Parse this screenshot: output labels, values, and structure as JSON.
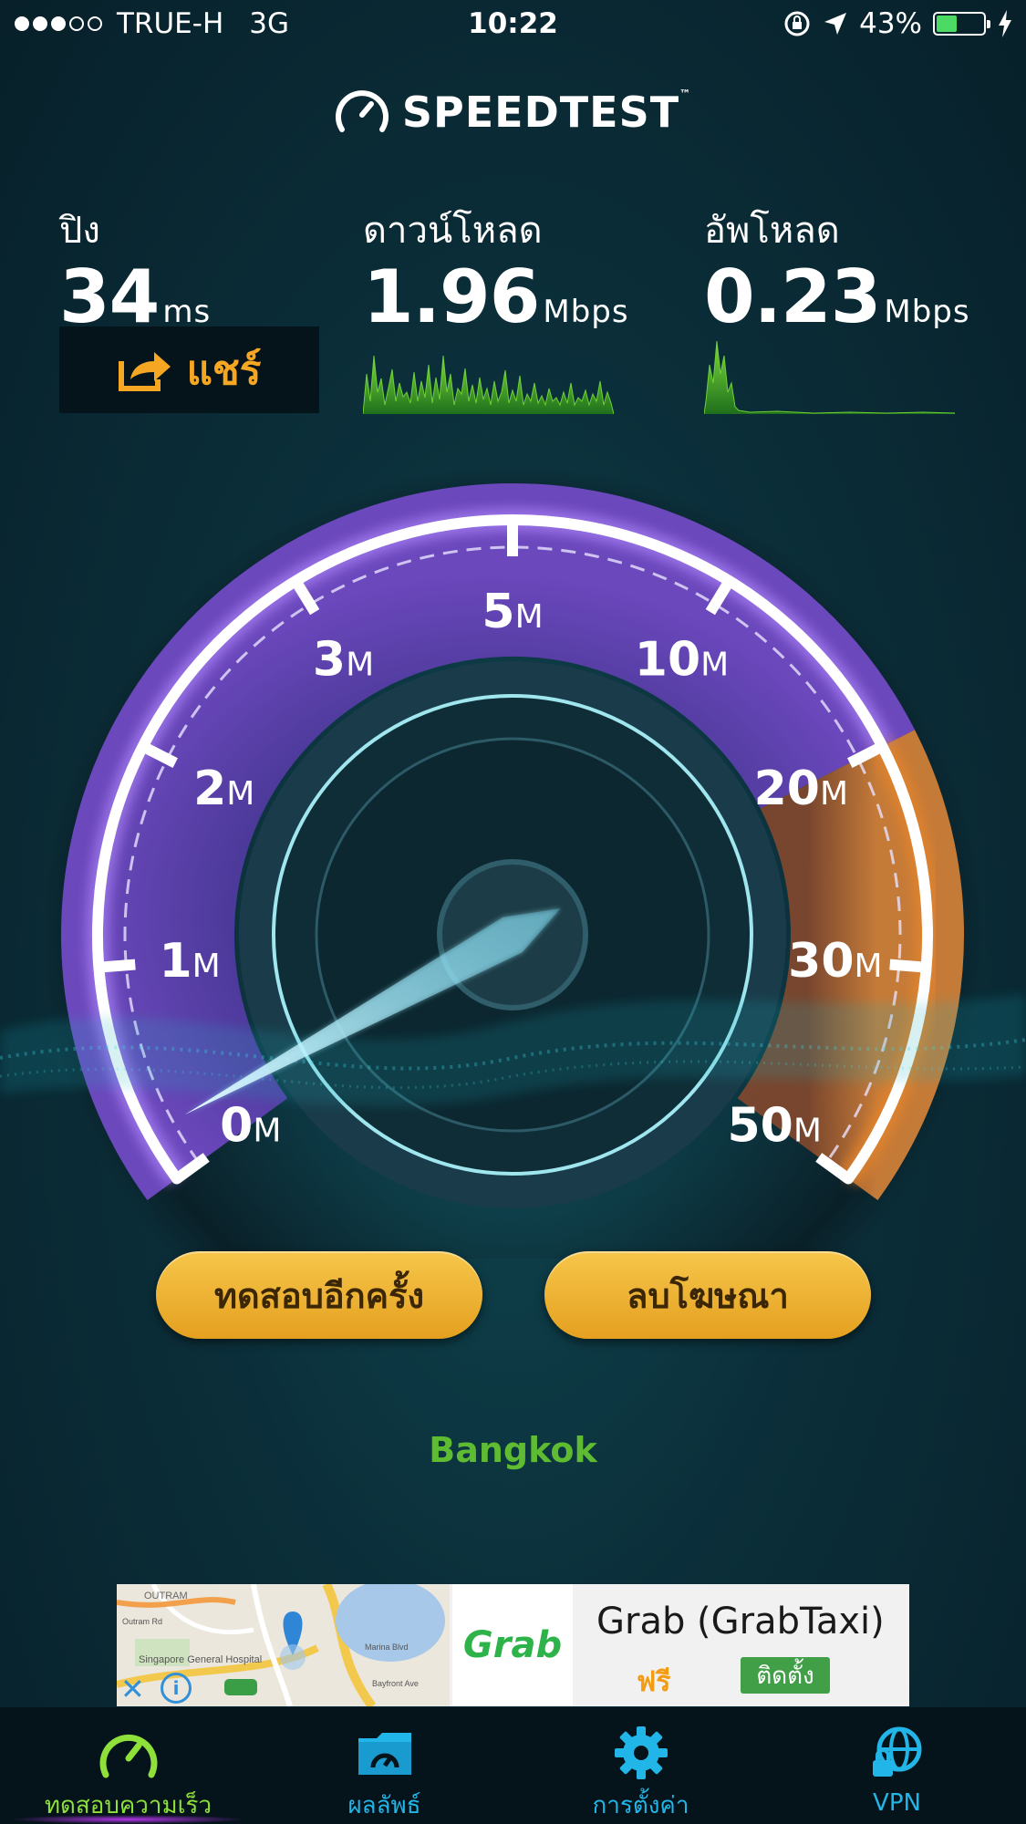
{
  "status": {
    "carrier": "TRUE-H",
    "network": "3G",
    "time": "10:22",
    "battery": "43%",
    "battery_fraction": 0.43,
    "signal_bars": 3,
    "signal_total": 5
  },
  "app": {
    "title": "SPEEDTEST",
    "tm": "™"
  },
  "metrics": {
    "ping": {
      "label": "ปิง",
      "value": "34",
      "unit": "ms"
    },
    "download": {
      "label": "ดาวน์โหลด",
      "value": "1.96",
      "unit": "Mbps"
    },
    "upload": {
      "label": "อัพโหลด",
      "value": "0.23",
      "unit": "Mbps"
    }
  },
  "share_label": "แชร์",
  "gauge": {
    "ticks": [
      {
        "num": "0",
        "suffix": "M"
      },
      {
        "num": "1",
        "suffix": "M"
      },
      {
        "num": "2",
        "suffix": "M"
      },
      {
        "num": "3",
        "suffix": "M"
      },
      {
        "num": "5",
        "suffix": "M"
      },
      {
        "num": "10",
        "suffix": "M"
      },
      {
        "num": "20",
        "suffix": "M"
      },
      {
        "num": "30",
        "suffix": "M"
      },
      {
        "num": "50",
        "suffix": "M"
      }
    ],
    "needle_value_mbps": 0.23,
    "colors": {
      "purple": "#6a3fb8",
      "orange": "#e8862a",
      "needle": "#8fe8ff"
    }
  },
  "buttons": {
    "test_again": "ทดสอบอีกครั้ง",
    "remove_ads": "ลบโฆษณา"
  },
  "server": {
    "city": "Bangkok"
  },
  "ad": {
    "brand": "Grab",
    "title": "Grab (GrabTaxi)",
    "price": "ฟรี",
    "install": "ติดตั้ง",
    "map_labels": [
      "OUTRAM",
      "Singapore General Hospital",
      "Marina Blvd",
      "Bayfront Ave",
      "Outram Rd"
    ]
  },
  "tabs": [
    {
      "label": "ทดสอบความเร็ว",
      "icon": "speedometer-icon",
      "active": true
    },
    {
      "label": "ผลลัพธ์",
      "icon": "results-folder-icon",
      "active": false
    },
    {
      "label": "การตั้งค่า",
      "icon": "gear-icon",
      "active": false
    },
    {
      "label": "VPN",
      "icon": "vpn-globe-lock-icon",
      "active": false
    }
  ]
}
